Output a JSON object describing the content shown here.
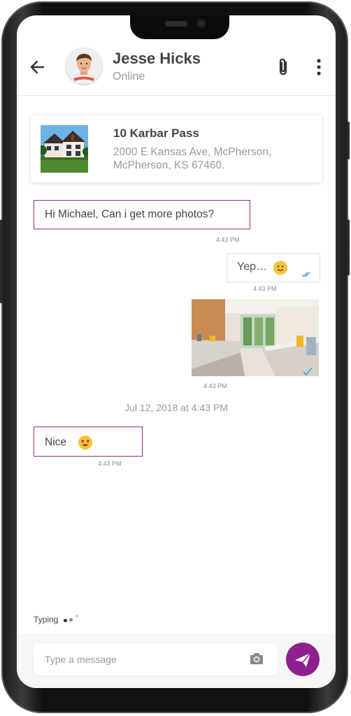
{
  "header": {
    "contact_name": "Jesse Hicks",
    "contact_status": "Online"
  },
  "property": {
    "title": "10 Karbar Pass",
    "address_line1": "2000 E Kansas Ave, McPherson,",
    "address_line2": "McPherson, KS 67460."
  },
  "messages": [
    {
      "direction": "incoming",
      "text": "Hi Michael, Can i get more photos?",
      "time": "4:43 PM"
    },
    {
      "direction": "outgoing",
      "text": "Yep…",
      "emoji": "slightly-smiling-face",
      "time": "4:43 PM",
      "status": "read"
    },
    {
      "direction": "outgoing",
      "type": "photo",
      "photo": "kitchen-photo",
      "time": "4:43 PM",
      "status": "read"
    },
    {
      "direction": "incoming",
      "text": "Nice",
      "emoji": "heart-eyes-face",
      "time": "4:43 PM"
    }
  ],
  "date_separator": "Jul 12, 2018 at 4:43 PM",
  "typing": {
    "label": "Typing"
  },
  "composer": {
    "placeholder": "Type a message"
  },
  "colors": {
    "accent": "#8e1f8e",
    "incoming_border": "#8e2a8e",
    "read_check": "#3fa7e0",
    "muted_text": "#9a9a9a"
  },
  "icons": {
    "back": "back-arrow-icon",
    "attach": "paperclip-icon",
    "more": "more-vertical-icon",
    "camera": "camera-icon",
    "send": "send-icon"
  }
}
